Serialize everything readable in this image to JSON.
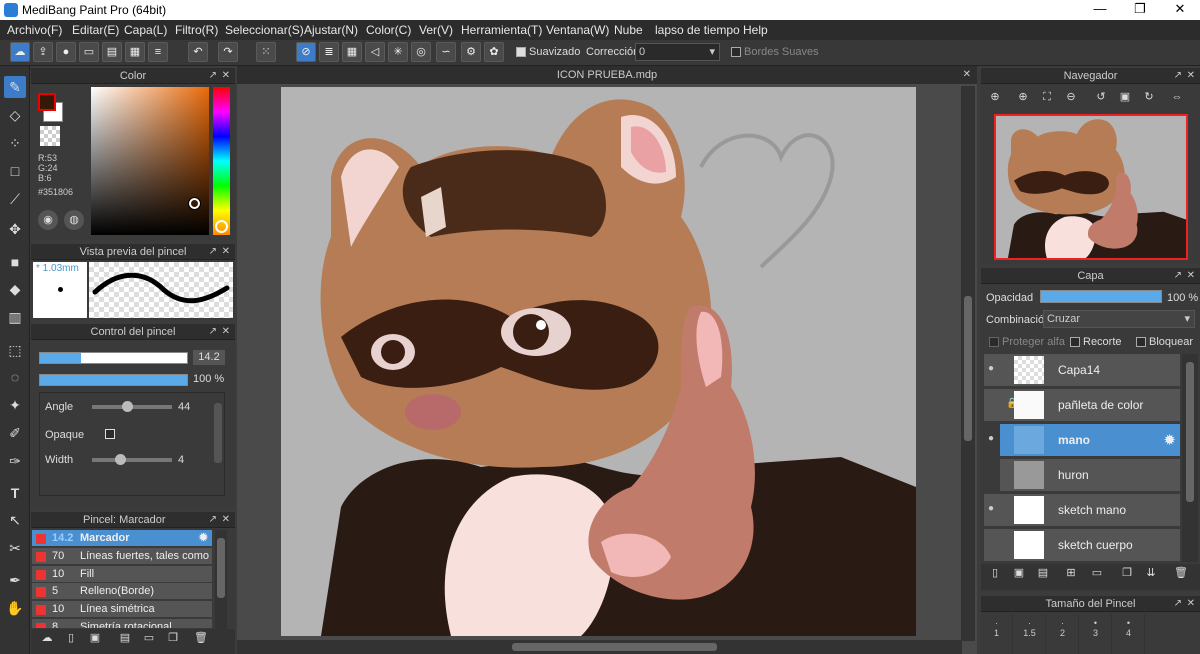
{
  "window": {
    "title": "MediBang Paint Pro (64bit)",
    "min": "—",
    "max": "❐",
    "close": "✕"
  },
  "menu": [
    "Archivo(F)",
    "Editar(E)",
    "Capa(L)",
    "Filtro(R)",
    "Seleccionar(S)",
    "Ajustar(N)",
    "Color(C)",
    "Ver(V)",
    "Herramienta(T)",
    "Ventana(W)",
    "Nube",
    "lapso de tiempo",
    "Help"
  ],
  "toolbar": {
    "suavizado": "Suavizado",
    "correccion": "Corrección",
    "correccion_value": "0",
    "bordes": "Bordes Suaves"
  },
  "color_panel": {
    "title": "Color",
    "r": "R:53",
    "g": "G:24",
    "b": "B:6",
    "hex": "#351806",
    "fg": "#351806"
  },
  "brush_preview": {
    "title": "Vista previa del pincel",
    "size": "1.03mm"
  },
  "brush_control": {
    "title": "Control del pincel",
    "size_value": "14.2",
    "size_frac": 0.28,
    "opacity_value": "100 %",
    "opacity_frac": 1.0,
    "angle_label": "Angle",
    "angle_value": "44",
    "angle_frac": 0.44,
    "opaque_label": "Opaque",
    "width_label": "Width",
    "width_value": "4",
    "width_frac": 0.35
  },
  "brush_list": {
    "title": "Pincel: Marcador",
    "items": [
      {
        "size": "14.2",
        "name": "Marcador"
      },
      {
        "size": "70",
        "name": "Líneas fuertes, tales como M"
      },
      {
        "size": "10",
        "name": "Fill"
      },
      {
        "size": "5",
        "name": "Relleno(Borde)"
      },
      {
        "size": "10",
        "name": "Línea simétrica"
      },
      {
        "size": "8",
        "name": "Simetría rotacional"
      }
    ]
  },
  "canvas": {
    "tab": "ICON PRUEBA.mdp"
  },
  "navigator": {
    "title": "Navegador"
  },
  "layers": {
    "title": "Capa",
    "opacity_label": "Opacidad",
    "opacity_value": "100 %",
    "opacity_frac": 1.0,
    "blend_label": "Combinación",
    "blend_value": "Cruzar",
    "protect": "Proteger alfa",
    "clip": "Recorte",
    "lock": "Bloquear",
    "items": [
      {
        "name": "Capa14",
        "visible": true
      },
      {
        "name": "pañleta de color",
        "visible": false
      },
      {
        "name": "mano",
        "visible": true,
        "selected": true
      },
      {
        "name": "huron",
        "visible": false
      },
      {
        "name": "sketch mano",
        "visible": true
      },
      {
        "name": "sketch cuerpo",
        "visible": false
      }
    ]
  },
  "brush_size": {
    "title": "Tamaño del Pincel",
    "values": [
      "1",
      "1.5",
      "2",
      "3",
      "4"
    ]
  }
}
